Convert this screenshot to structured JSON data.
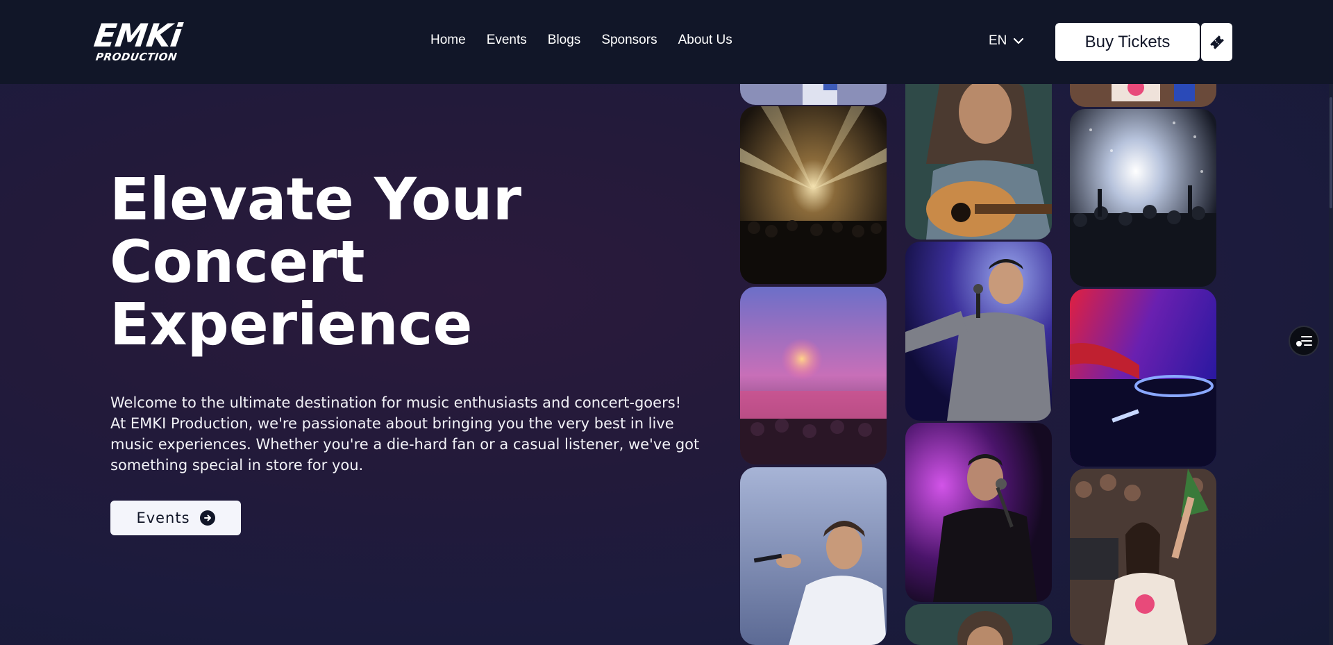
{
  "header": {
    "logo_main": "EMKi",
    "logo_sub": "PRODUCTION",
    "nav": [
      {
        "label": "Home"
      },
      {
        "label": "Events"
      },
      {
        "label": "Blogs"
      },
      {
        "label": "Sponsors"
      },
      {
        "label": "About Us"
      }
    ],
    "language": "EN",
    "buy_label": "Buy Tickets"
  },
  "hero": {
    "title_lines": [
      "Elevate Your",
      "Concert",
      "Experience"
    ],
    "description": "Welcome to the ultimate destination for music enthusiasts and concert-goers! At EMKI Production, we're passionate about bringing you the very best in live music experiences. Whether you're a die-hard fan or a casual listener, we've got something special in store for you.",
    "events_label": "Events"
  },
  "icons": {
    "language_chevron": "chevron-down-icon",
    "ticket": "ticket-icon",
    "events_arrow": "arrow-right-circle-icon",
    "side_fab": "accessibility-menu-icon"
  },
  "colors": {
    "header_bg": "#111628",
    "hero_bg": "#231a3a",
    "button_bg": "#ffffff",
    "text": "#ffffff"
  }
}
